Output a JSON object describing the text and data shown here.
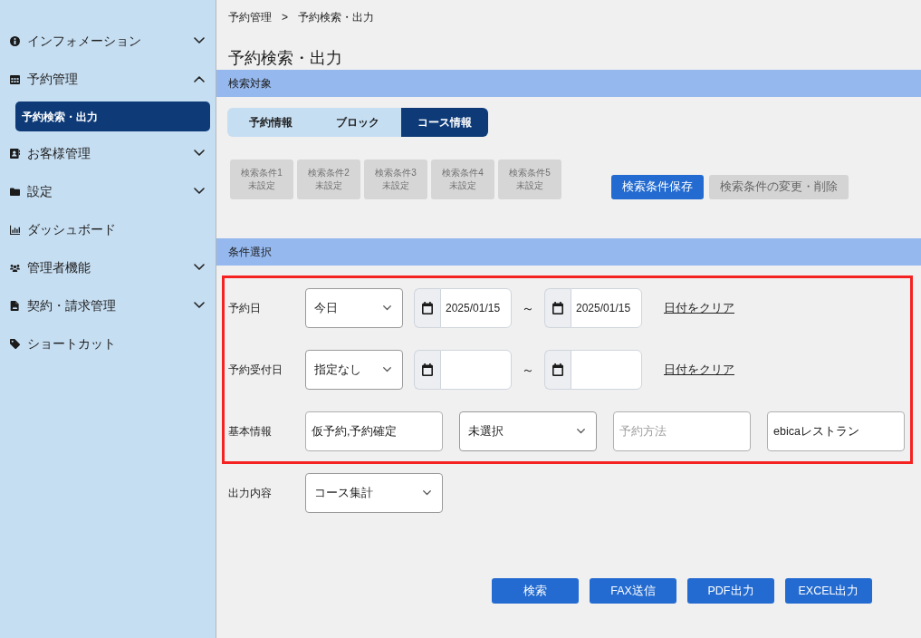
{
  "sidebar": {
    "items": [
      {
        "label": "インフォメーション",
        "kind": "group",
        "expanded": false,
        "selected": false
      },
      {
        "label": "予約管理",
        "kind": "group",
        "expanded": true,
        "selected": false,
        "children": [
          {
            "label": "予約検索・出力",
            "selected": true
          }
        ]
      },
      {
        "label": "お客様管理",
        "kind": "group",
        "expanded": false,
        "selected": false
      },
      {
        "label": "設定",
        "kind": "group",
        "expanded": false,
        "selected": false
      },
      {
        "label": "ダッシュボード",
        "kind": "link",
        "selected": false
      },
      {
        "label": "管理者機能",
        "kind": "group",
        "expanded": false,
        "selected": false
      },
      {
        "label": "契約・請求管理",
        "kind": "group",
        "expanded": false,
        "selected": false
      },
      {
        "label": "ショートカット",
        "kind": "link",
        "selected": false
      }
    ]
  },
  "breadcrumb": {
    "items": [
      "予約管理",
      "予約検索・出力"
    ],
    "separator": ">"
  },
  "page_title": "予約検索・出力",
  "search_target": {
    "title": "検索対象",
    "tabs": [
      {
        "label": "予約情報",
        "selected": false
      },
      {
        "label": "ブロック",
        "selected": false
      },
      {
        "label": "コース情報",
        "selected": true
      }
    ],
    "presets": [
      {
        "name": "検索条件1",
        "status": "未設定",
        "disabled": true
      },
      {
        "name": "検索条件2",
        "status": "未設定",
        "disabled": true
      },
      {
        "name": "検索条件3",
        "status": "未設定",
        "disabled": true
      },
      {
        "name": "検索条件4",
        "status": "未設定",
        "disabled": true
      },
      {
        "name": "検索条件5",
        "status": "未設定",
        "disabled": true
      }
    ],
    "actions": [
      {
        "label": "検索条件保存",
        "disabled": false
      },
      {
        "label": "検索条件の変更・削除",
        "disabled": true
      }
    ]
  },
  "conditions": {
    "title": "条件選択",
    "groups": [
      {
        "highlighted": true,
        "rows": [
          {
            "label": "予約日",
            "kind": "date_range",
            "select": "今日",
            "from": "2025/01/15",
            "to": "2025/01/15",
            "separator": "～",
            "clear_link": "日付をクリア"
          },
          {
            "label": "予約受付日",
            "kind": "date_range",
            "select": "指定なし",
            "separator": "～",
            "clear_link": "日付をクリア"
          },
          {
            "label": "基本情報",
            "kind": "fields",
            "fields": [
              {
                "kind": "text",
                "value": "仮予約,予約確定"
              },
              {
                "kind": "select",
                "value": "未選択"
              },
              {
                "kind": "text",
                "placeholder": "予約方法"
              },
              {
                "kind": "text",
                "value": "ebicaレストラン"
              }
            ]
          }
        ]
      },
      {
        "highlighted": false,
        "rows": [
          {
            "label": "出力内容",
            "kind": "fields",
            "fields": [
              {
                "kind": "select",
                "value": "コース集計"
              }
            ]
          }
        ]
      }
    ]
  },
  "buttons": [
    "検索",
    "FAX送信",
    "PDF出力",
    "EXCEL出力"
  ]
}
